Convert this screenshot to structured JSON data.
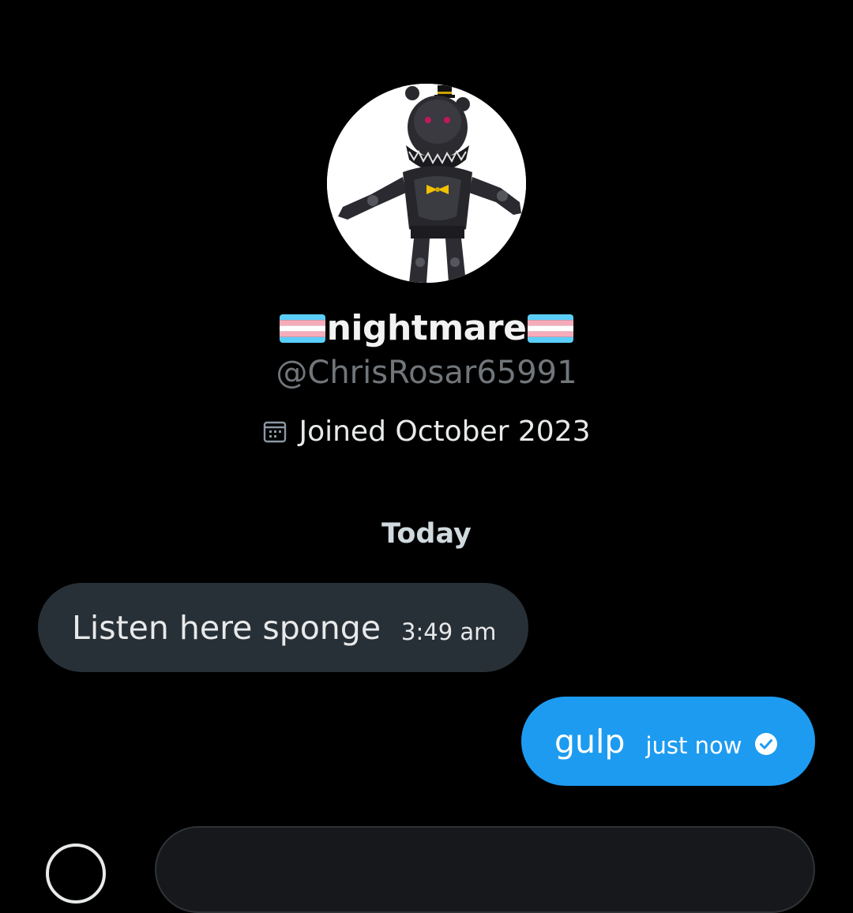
{
  "profile": {
    "display_name": "nightmare",
    "handle": "@ChrisRosar65991",
    "joined": "Joined October 2023",
    "avatar_icon": "avatar-image",
    "flag_icon": "transgender-flag-emoji"
  },
  "conversation": {
    "day_label": "Today",
    "messages": [
      {
        "direction": "received",
        "text": "Listen here sponge",
        "time": "3:49 am"
      },
      {
        "direction": "sent",
        "text": "gulp",
        "time": "just now",
        "status_icon": "seen-check-icon"
      }
    ]
  },
  "colors": {
    "background": "#000000",
    "received_bubble": "#283037",
    "sent_bubble": "#1d9bf0",
    "secondary_text": "#71767b"
  }
}
